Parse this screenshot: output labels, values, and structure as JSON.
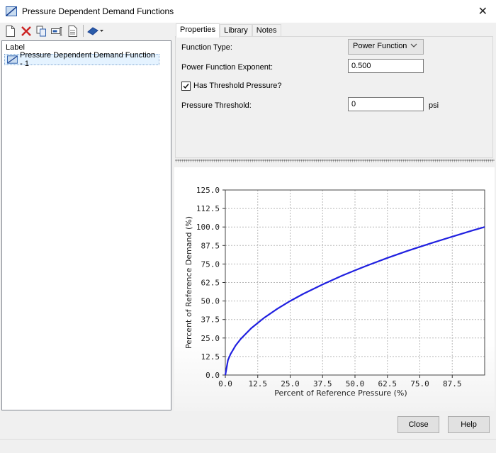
{
  "window": {
    "title": "Pressure Dependent Demand Functions"
  },
  "toolbar": {
    "icons": [
      "new-icon",
      "delete-icon",
      "duplicate-icon",
      "rename-icon",
      "report-icon",
      "synchronize-icon"
    ]
  },
  "list": {
    "header": "Label",
    "items": [
      {
        "label": "Pressure Dependent Demand Function - 1"
      }
    ]
  },
  "tabs": [
    {
      "label": "Properties"
    },
    {
      "label": "Library"
    },
    {
      "label": "Notes"
    }
  ],
  "properties": {
    "function_type_label": "Function Type:",
    "function_type_value": "Power Function",
    "exponent_label": "Power Function Exponent:",
    "exponent_value": "0.500",
    "threshold_check_label": "Has Threshold Pressure?",
    "threshold_checked": true,
    "threshold_label": "Pressure Threshold:",
    "threshold_value": "0",
    "threshold_unit": "psi"
  },
  "buttons": {
    "close": "Close",
    "help": "Help"
  },
  "colors": {
    "curve": "#2020e0",
    "selection": "#e5f3ff"
  },
  "chart_data": {
    "type": "line",
    "xlabel": "Percent of Reference Pressure (%)",
    "ylabel": "Percent of Reference Demand (%)",
    "xlim": [
      0,
      100
    ],
    "ylim": [
      0,
      125
    ],
    "xticks": [
      "0.0",
      "12.5",
      "25.0",
      "37.5",
      "50.0",
      "62.5",
      "75.0",
      "87.5"
    ],
    "yticks": [
      "0.0",
      "12.5",
      "25.0",
      "37.5",
      "50.0",
      "62.5",
      "75.0",
      "87.5",
      "100.0",
      "112.5",
      "125.0"
    ],
    "grid": true,
    "series": [
      {
        "x": [
          0,
          1,
          2,
          4,
          6,
          10,
          15,
          20,
          25,
          30,
          37.5,
          45,
          50,
          55,
          62.5,
          70,
          75,
          80,
          87.5,
          95,
          100
        ],
        "y": [
          0,
          10,
          14.1,
          20,
          24.5,
          31.6,
          38.7,
          44.7,
          50,
          54.8,
          61.2,
          67.1,
          70.7,
          74.2,
          79.1,
          83.7,
          86.6,
          89.4,
          93.5,
          97.5,
          100
        ]
      }
    ]
  }
}
